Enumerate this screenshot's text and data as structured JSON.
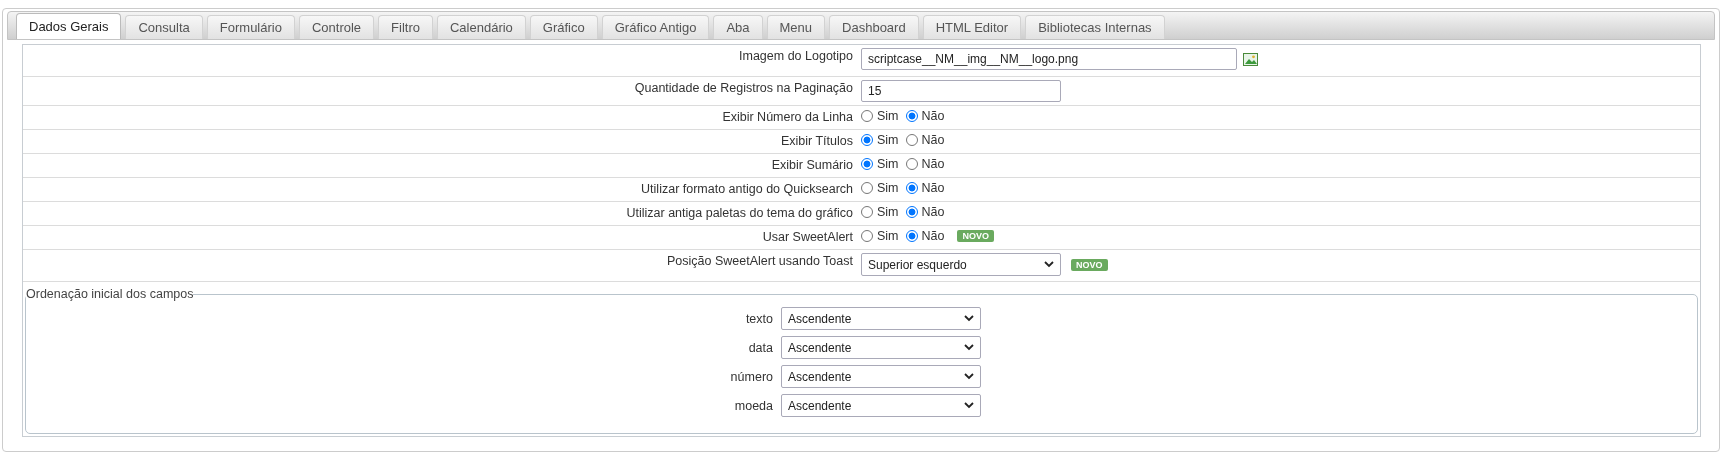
{
  "tabs": [
    {
      "label": "Dados Gerais",
      "selected": true
    },
    {
      "label": "Consulta",
      "selected": false
    },
    {
      "label": "Formulário",
      "selected": false
    },
    {
      "label": "Controle",
      "selected": false
    },
    {
      "label": "Filtro",
      "selected": false
    },
    {
      "label": "Calendário",
      "selected": false
    },
    {
      "label": "Gráfico",
      "selected": false
    },
    {
      "label": "Gráfico Antigo",
      "selected": false
    },
    {
      "label": "Aba",
      "selected": false
    },
    {
      "label": "Menu",
      "selected": false
    },
    {
      "label": "Dashboard",
      "selected": false
    },
    {
      "label": "HTML Editor",
      "selected": false
    },
    {
      "label": "Bibliotecas Internas",
      "selected": false
    }
  ],
  "settings": [
    {
      "kind": "file",
      "label": "Imagem do Logotipo",
      "value": "scriptcase__NM__img__NM__logo.png"
    },
    {
      "kind": "text",
      "label": "Quantidade de Registros na Paginação",
      "value": "15"
    },
    {
      "kind": "radio",
      "label": "Exibir Número da Linha",
      "options": [
        {
          "label": "Sim",
          "selected": false
        },
        {
          "label": "Não",
          "selected": true
        }
      ]
    },
    {
      "kind": "radio",
      "label": "Exibir Títulos",
      "options": [
        {
          "label": "Sim",
          "selected": true
        },
        {
          "label": "Não",
          "selected": false
        }
      ]
    },
    {
      "kind": "radio",
      "label": "Exibir Sumário",
      "options": [
        {
          "label": "Sim",
          "selected": true
        },
        {
          "label": "Não",
          "selected": false
        }
      ]
    },
    {
      "kind": "radio",
      "label": "Utilizar formato antigo do Quicksearch",
      "options": [
        {
          "label": "Sim",
          "selected": false
        },
        {
          "label": "Não",
          "selected": true
        }
      ]
    },
    {
      "kind": "radio",
      "label": "Utilizar antiga paletas do tema do gráfico",
      "options": [
        {
          "label": "Sim",
          "selected": false
        },
        {
          "label": "Não",
          "selected": true
        }
      ]
    },
    {
      "kind": "radio",
      "label": "Usar SweetAlert",
      "options": [
        {
          "label": "Sim",
          "selected": false
        },
        {
          "label": "Não",
          "selected": true
        }
      ],
      "badge": "NOVO"
    },
    {
      "kind": "select",
      "label": "Posição SweetAlert usando Toast",
      "value": "Superior esquerdo",
      "badge": "NOVO"
    }
  ],
  "ordering": {
    "legend": "Ordenação inicial dos campos",
    "fields": [
      {
        "label": "texto",
        "value": "Ascendente"
      },
      {
        "label": "data",
        "value": "Ascendente"
      },
      {
        "label": "número",
        "value": "Ascendente"
      },
      {
        "label": "moeda",
        "value": "Ascendente"
      }
    ]
  }
}
